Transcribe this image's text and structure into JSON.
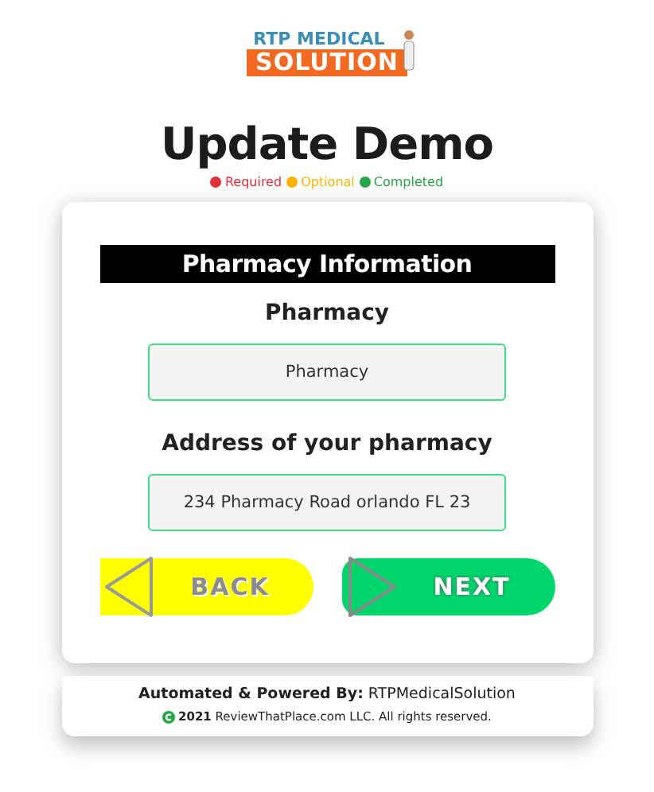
{
  "logo": {
    "line1": "RTP MEDICAL",
    "line2": "SOLUTION"
  },
  "title": "Update Demo",
  "legend": [
    {
      "label": "Required",
      "color": "#e0303c"
    },
    {
      "label": "Optional",
      "color": "#ffb300"
    },
    {
      "label": "Completed",
      "color": "#26a646"
    }
  ],
  "section": {
    "heading": "Pharmacy Information",
    "fields": [
      {
        "label": "Pharmacy",
        "value": "Pharmacy"
      },
      {
        "label": "Address of your pharmacy",
        "value": "234 Pharmacy Road orlando FL 23"
      }
    ]
  },
  "buttons": [
    {
      "kind": "back",
      "label": "BACK"
    },
    {
      "kind": "next",
      "label": "NEXT"
    }
  ],
  "footer": {
    "powered": "**Automated & Powered By:** RTPMedicalSolution",
    "copyright": "**2021** ReviewThatPlace.com LLC. All rights reserved."
  }
}
